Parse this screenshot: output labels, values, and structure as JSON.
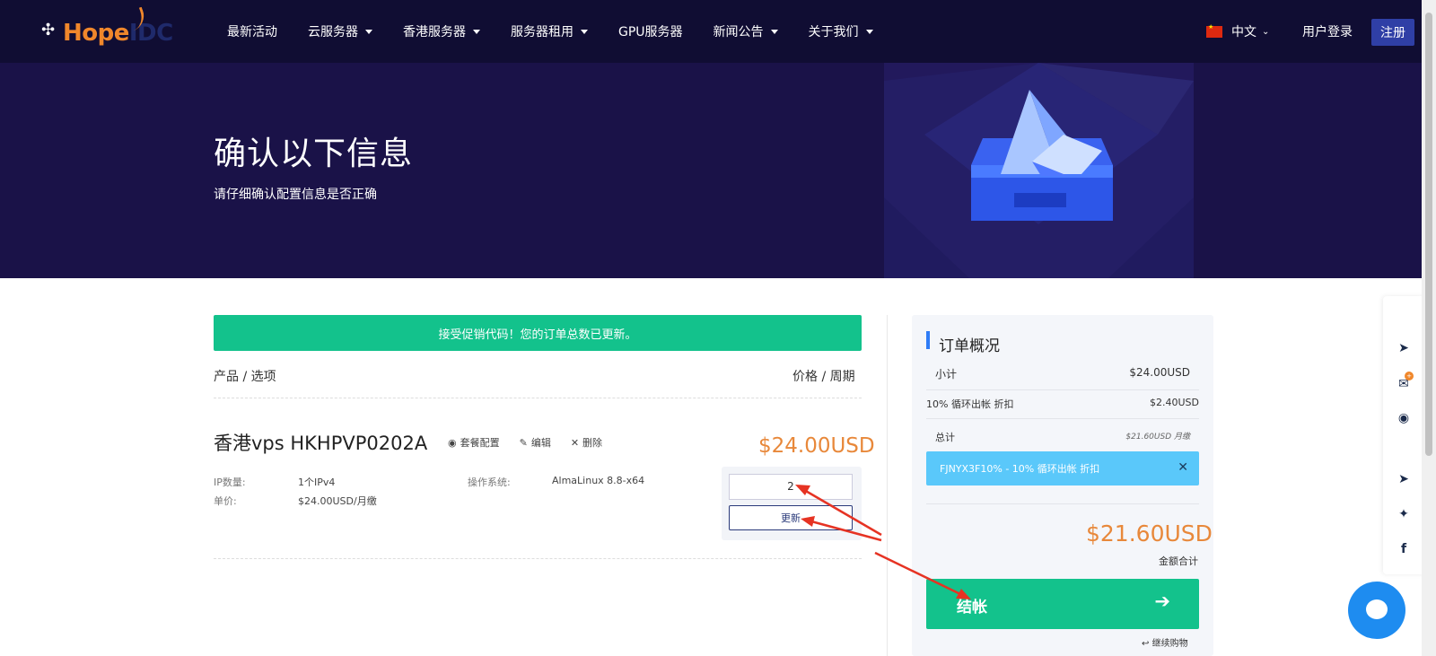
{
  "brand": {
    "logo_text_a": "Hope",
    "logo_text_b": "IDC",
    "logo_sub": ""
  },
  "nav": {
    "items": [
      {
        "label": "最新活动",
        "has_caret": false
      },
      {
        "label": "云服务器",
        "has_caret": true
      },
      {
        "label": "香港服务器",
        "has_caret": true
      },
      {
        "label": "服务器租用",
        "has_caret": true
      },
      {
        "label": "GPU服务器",
        "has_caret": false
      },
      {
        "label": "新闻公告",
        "has_caret": true
      },
      {
        "label": "关于我们",
        "has_caret": true
      }
    ],
    "language": "中文",
    "login": "用户登录",
    "register": "注册"
  },
  "hero": {
    "title": "确认以下信息",
    "subtitle": "请仔细确认配置信息是否正确"
  },
  "alert": {
    "text": "接受促销代码！您的订单总数已更新。"
  },
  "cart": {
    "col_left": "产品 / 选项",
    "col_right": "价格 / 周期",
    "product": {
      "name": "香港vps HKHPVP0202A",
      "actions": {
        "view": "套餐配置",
        "edit": "编辑",
        "delete": "删除"
      },
      "price": "$24.00USD",
      "specs": {
        "ip_label": "IP数量:",
        "ip_value": "1个IPv4",
        "os_label": "操作系统:",
        "os_value": "AlmaLinux 8.8-x64",
        "unit_label": "单价:",
        "unit_value": "$24.00USD/月缴"
      },
      "quantity": "2",
      "update_label": "更新"
    }
  },
  "summary": {
    "title": "订单概况",
    "subtotal_label": "小计",
    "subtotal_value": "$24.00USD",
    "discount_label": "10% 循环出帐 折扣",
    "discount_value": "$2.40USD",
    "total_label": "总计",
    "total_value": "$21.60USD 月缴",
    "promo_text": "FJNYX3F10% - 10% 循环出帐 折扣",
    "grand_total": "$21.60USD",
    "grand_total_label": "金额合计",
    "checkout_label": "结帐",
    "continue_label": "继续购物"
  },
  "float_bar": {
    "mail_badge": "+"
  },
  "colors": {
    "nav_bg": "#100d33",
    "hero_bg": "#1a1248",
    "accent_green": "#13c28c",
    "price_orange": "#e8883a",
    "promo_blue": "#5ac8fa",
    "register_blue": "#2f3fa6",
    "annotation_red": "#e63323"
  }
}
